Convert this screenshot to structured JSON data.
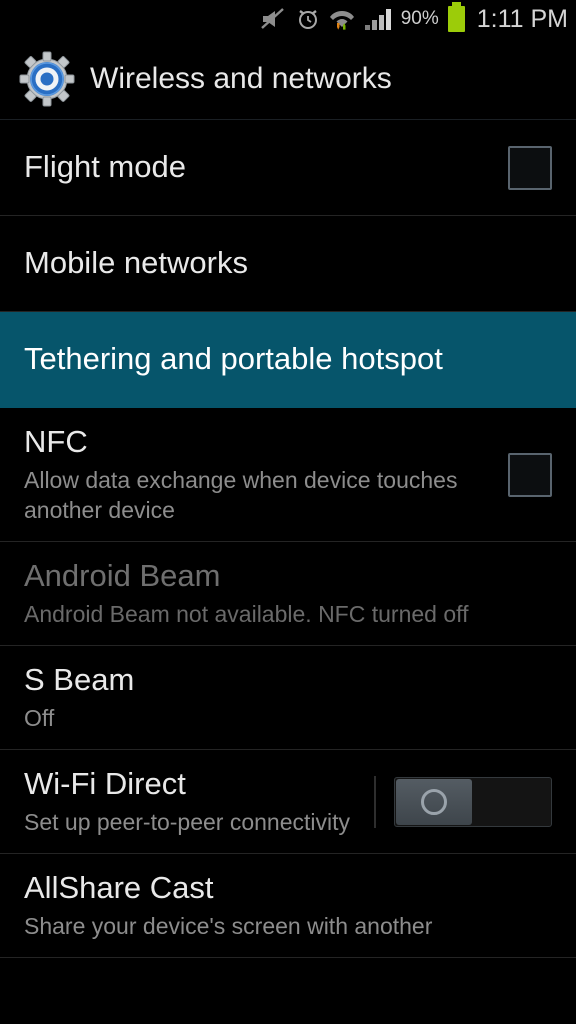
{
  "status_bar": {
    "icons": [
      "mute-icon",
      "alarm-icon",
      "wifi-data-icon",
      "signal-bars-icon"
    ],
    "battery_percent": "90%",
    "battery_icon": "battery-full-icon",
    "time": "1:11 PM"
  },
  "header": {
    "icon": "settings-gear-icon",
    "title": "Wireless and networks",
    "gradient_top": "#4e5d6e",
    "gradient_bottom": "#343f4a"
  },
  "colors": {
    "selected_row": "#06556b",
    "battery_green": "#9ccc09",
    "title_text": "#e9e9e9",
    "subtitle_text": "#8d8d8d",
    "disabled_text": "#6f6f6f"
  },
  "list": {
    "items": [
      {
        "title": "Flight mode",
        "subtitle": "",
        "control": "checkbox",
        "checked": false,
        "selected": false,
        "disabled": false
      },
      {
        "title": "Mobile networks",
        "subtitle": "",
        "control": "none",
        "selected": false,
        "disabled": false
      },
      {
        "title": "Tethering and portable hotspot",
        "subtitle": "",
        "control": "none",
        "selected": true,
        "disabled": false
      },
      {
        "title": "NFC",
        "subtitle": "Allow data exchange when device touches another device",
        "control": "checkbox",
        "checked": false,
        "selected": false,
        "disabled": false
      },
      {
        "title": "Android Beam",
        "subtitle": "Android Beam not available. NFC turned off",
        "control": "none",
        "selected": false,
        "disabled": true
      },
      {
        "title": "S Beam",
        "subtitle": "Off",
        "control": "none",
        "selected": false,
        "disabled": false
      },
      {
        "title": "Wi-Fi Direct",
        "subtitle": "Set up peer-to-peer connectivity",
        "control": "toggle",
        "toggle_on": false,
        "selected": false,
        "disabled": false
      },
      {
        "title": "AllShare Cast",
        "subtitle": "Share your device's screen with another",
        "control": "none",
        "selected": false,
        "disabled": false
      }
    ]
  }
}
